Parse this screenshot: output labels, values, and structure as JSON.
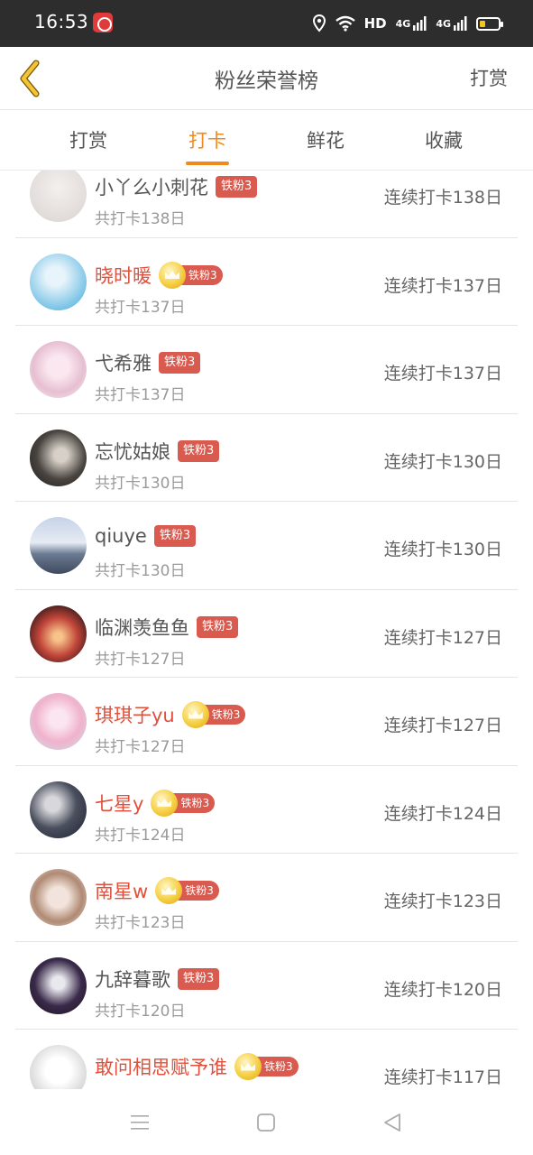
{
  "status_bar": {
    "time": "16:53",
    "network_label": "HD",
    "signal1_label": "4G",
    "signal2_label": "4G",
    "icons": [
      "app-notification-icon",
      "location-icon",
      "wifi-icon",
      "signal-icon",
      "signal-icon",
      "battery-icon"
    ]
  },
  "header": {
    "back_icon": "chevron-left-icon",
    "title": "粉丝荣誉榜",
    "action_label": "打赏"
  },
  "tabs": [
    {
      "label": "打赏",
      "active": false
    },
    {
      "label": "打卡",
      "active": true
    },
    {
      "label": "鲜花",
      "active": false
    },
    {
      "label": "收藏",
      "active": false
    }
  ],
  "colors": {
    "accent": "#f08a1c",
    "vip_name": "#e0503c",
    "badge_bg": "#d95a4e"
  },
  "fans": [
    {
      "name": "小丫么小刺花",
      "badge": "铁粉3",
      "vip": false,
      "total": "共打卡138日",
      "streak": "连续打卡138日"
    },
    {
      "name": "晓时暖",
      "badge": "铁粉3",
      "vip": true,
      "total": "共打卡137日",
      "streak": "连续打卡137日"
    },
    {
      "name": "弋希雅",
      "badge": "铁粉3",
      "vip": false,
      "total": "共打卡137日",
      "streak": "连续打卡137日"
    },
    {
      "name": "忘忧姑娘",
      "badge": "铁粉3",
      "vip": false,
      "total": "共打卡130日",
      "streak": "连续打卡130日"
    },
    {
      "name": "qiuye",
      "badge": "铁粉3",
      "vip": false,
      "total": "共打卡130日",
      "streak": "连续打卡130日"
    },
    {
      "name": "临渊羡鱼鱼",
      "badge": "铁粉3",
      "vip": false,
      "total": "共打卡127日",
      "streak": "连续打卡127日"
    },
    {
      "name": "琪琪子yu",
      "badge": "铁粉3",
      "vip": true,
      "total": "共打卡127日",
      "streak": "连续打卡127日"
    },
    {
      "name": "七星y",
      "badge": "铁粉3",
      "vip": true,
      "total": "共打卡124日",
      "streak": "连续打卡124日"
    },
    {
      "name": "南星w",
      "badge": "铁粉3",
      "vip": true,
      "total": "共打卡123日",
      "streak": "连续打卡123日"
    },
    {
      "name": "九辞暮歌",
      "badge": "铁粉3",
      "vip": false,
      "total": "共打卡120日",
      "streak": "连续打卡120日"
    },
    {
      "name": "敢问相思赋予谁",
      "badge": "铁粉3",
      "vip": true,
      "total": "共打卡117日",
      "streak": "连续打卡117日"
    }
  ],
  "nav_bar": {
    "icons": [
      "menu-icon",
      "home-icon",
      "back-triangle-icon"
    ]
  }
}
